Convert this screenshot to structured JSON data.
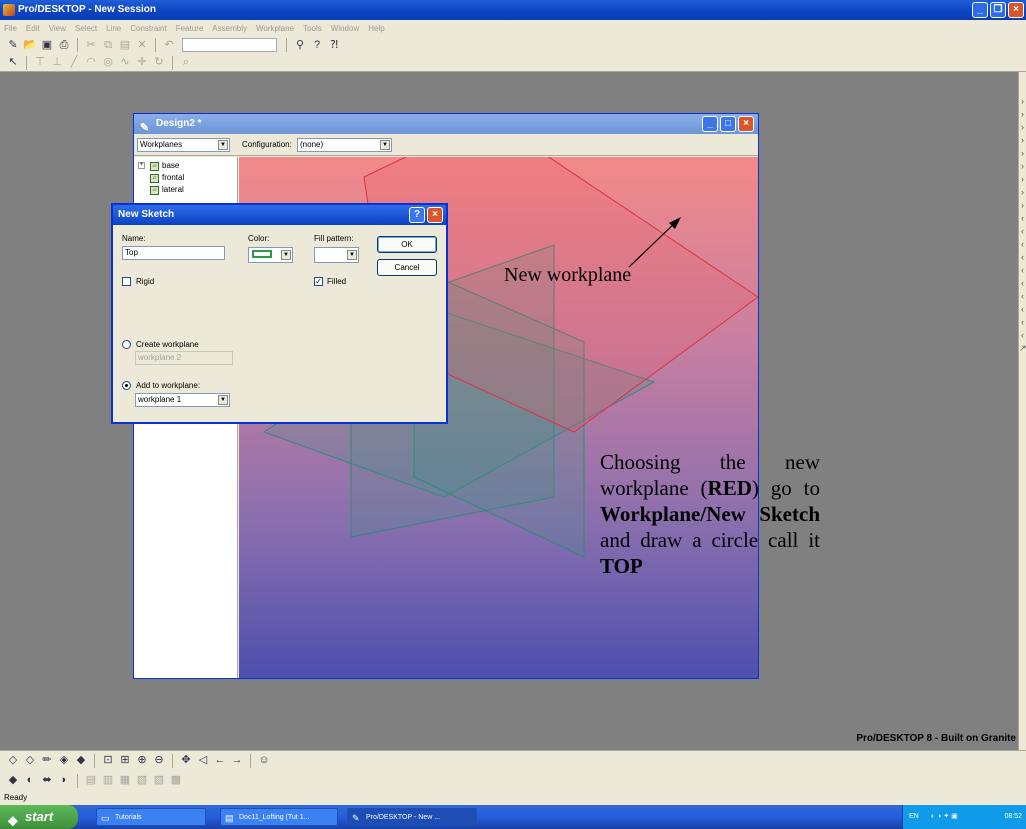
{
  "app": {
    "title": "Pro/DESKTOP - New Session",
    "brand": "Pro/DESKTOP 8 - Built on Granite"
  },
  "menu": [
    "File",
    "Edit",
    "View",
    "Select",
    "Line",
    "Constraint",
    "Feature",
    "Assembly",
    "Workplane",
    "Tools",
    "Window",
    "Help"
  ],
  "design_window": {
    "title": "Design2 *",
    "browser_select": "Workplanes",
    "configuration_label": "Configuration:",
    "configuration_value": "(none)",
    "tree": [
      "base",
      "frontal",
      "lateral"
    ]
  },
  "dialog": {
    "title": "New Sketch",
    "name_label": "Name:",
    "name_value": "Top",
    "color_label": "Color:",
    "fill_label": "Fill pattern:",
    "rigid_label": "Rigid",
    "rigid_checked": false,
    "filled_label": "Filled",
    "filled_checked": true,
    "ok_label": "OK",
    "cancel_label": "Cancel",
    "create_workplane_label": "Create workplane",
    "create_workplane_value": "workplane 2",
    "add_to_workplane_label": "Add to workplane:",
    "add_to_workplane_value": "workplane 1",
    "selected_option": "add_to_workplane",
    "sketch_color": "#2a9a4a"
  },
  "annotations": {
    "label": "New workplane",
    "instruction_1": "Choosing the new workplane (",
    "instruction_red": "RED",
    "instruction_2": ") go to ",
    "instruction_menu": "Workplane/New Sketch",
    "instruction_3": " and draw a circle call it ",
    "instruction_name": "TOP"
  },
  "status": "Ready",
  "taskbar": {
    "start": "start",
    "tasks": [
      "Tutorials",
      "Doc11_Lofting (Tut 1...",
      "Pro/DESKTOP - New ..."
    ],
    "lang": "EN",
    "clock": "08:52"
  }
}
